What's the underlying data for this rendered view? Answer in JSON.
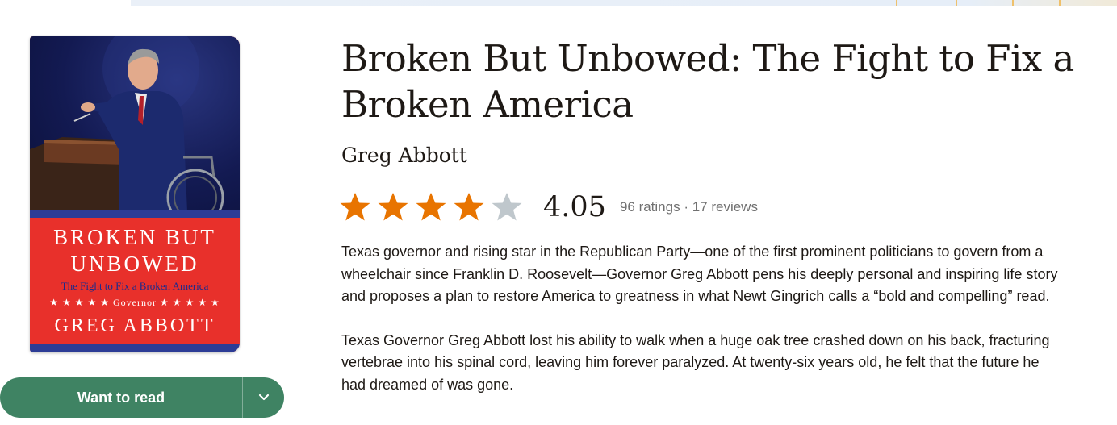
{
  "cover": {
    "title_line1": "BROKEN BUT",
    "title_line2": "UNBOWED",
    "subtitle": "The Fight to Fix a Broken America",
    "badge": "★ ★ ★ ★ ★  Governor  ★ ★ ★ ★ ★",
    "author": "GREG ABBOTT",
    "colors": {
      "red": "#e8302b",
      "navy": "#131a52",
      "band": "#2c3c96"
    }
  },
  "actions": {
    "want_to_read": "Want to read",
    "toggle_icon": "chevron-down-icon",
    "color": "#3f8363"
  },
  "book": {
    "title": "Broken But Unbowed: The Fight to Fix a Broken America",
    "author": "Greg Abbott",
    "rating": {
      "average": "4.05",
      "stars_filled": 4,
      "stars_total": 5,
      "counts": "96 ratings · 17 reviews",
      "star_color": "#e87400",
      "empty_star_color": "#bfc7cc"
    },
    "description": [
      "Texas governor and rising star in the Republican Party—one of the first prominent politicians to govern from a wheelchair since Franklin D. Roosevelt—Governor Greg Abbott pens his deeply personal and inspiring life story and proposes a plan to restore America to greatness in what Newt Gingrich calls a “bold and compelling” read.",
      "Texas Governor Greg Abbott lost his ability to walk when a huge oak tree crashed down on his back, fracturing vertebrae into his spinal cord, leaving him forever paralyzed. At twenty-six years old, he felt that the future he had dreamed of was gone."
    ]
  }
}
